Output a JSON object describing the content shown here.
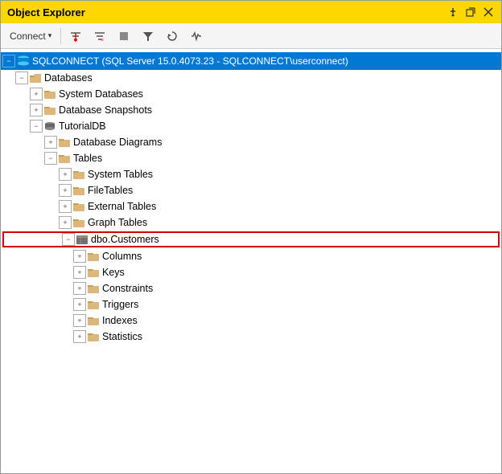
{
  "window": {
    "title": "Object Explorer",
    "controls": [
      "pin",
      "float",
      "close"
    ]
  },
  "toolbar": {
    "connect_label": "Connect",
    "icons": [
      "filter-icon",
      "filter-active-icon",
      "stop-icon",
      "filter2-icon",
      "refresh-icon",
      "activity-icon"
    ]
  },
  "tree": {
    "connection": "SQLCONNECT (SQL Server 15.0.4073.23 - SQLCONNECT\\userconnect)",
    "items": [
      {
        "id": "databases",
        "label": "Databases",
        "level": 1,
        "expanded": true,
        "type": "folder"
      },
      {
        "id": "system-databases",
        "label": "System Databases",
        "level": 2,
        "expanded": false,
        "type": "folder"
      },
      {
        "id": "database-snapshots",
        "label": "Database Snapshots",
        "level": 2,
        "expanded": false,
        "type": "folder"
      },
      {
        "id": "tutorialdb",
        "label": "TutorialDB",
        "level": 2,
        "expanded": true,
        "type": "database"
      },
      {
        "id": "database-diagrams",
        "label": "Database Diagrams",
        "level": 3,
        "expanded": false,
        "type": "folder"
      },
      {
        "id": "tables",
        "label": "Tables",
        "level": 3,
        "expanded": true,
        "type": "folder"
      },
      {
        "id": "system-tables",
        "label": "System Tables",
        "level": 4,
        "expanded": false,
        "type": "folder"
      },
      {
        "id": "filetables",
        "label": "FileTables",
        "level": 4,
        "expanded": false,
        "type": "folder"
      },
      {
        "id": "external-tables",
        "label": "External Tables",
        "level": 4,
        "expanded": false,
        "type": "folder"
      },
      {
        "id": "graph-tables",
        "label": "Graph Tables",
        "level": 4,
        "expanded": false,
        "type": "folder"
      },
      {
        "id": "dbo-customers",
        "label": "dbo.Customers",
        "level": 4,
        "expanded": true,
        "type": "table",
        "outlined": true
      },
      {
        "id": "columns",
        "label": "Columns",
        "level": 5,
        "expanded": false,
        "type": "folder"
      },
      {
        "id": "keys",
        "label": "Keys",
        "level": 5,
        "expanded": false,
        "type": "folder"
      },
      {
        "id": "constraints",
        "label": "Constraints",
        "level": 5,
        "expanded": false,
        "type": "folder"
      },
      {
        "id": "triggers",
        "label": "Triggers",
        "level": 5,
        "expanded": false,
        "type": "folder"
      },
      {
        "id": "indexes",
        "label": "Indexes",
        "level": 5,
        "expanded": false,
        "type": "folder"
      },
      {
        "id": "statistics",
        "label": "Statistics",
        "level": 5,
        "expanded": false,
        "type": "folder"
      }
    ]
  },
  "colors": {
    "titlebar": "#ffd700",
    "selected_bg": "#0078d4",
    "outline_color": "#cc0000",
    "folder_color": "#dcb67a",
    "folder_dark": "#c8a050"
  }
}
